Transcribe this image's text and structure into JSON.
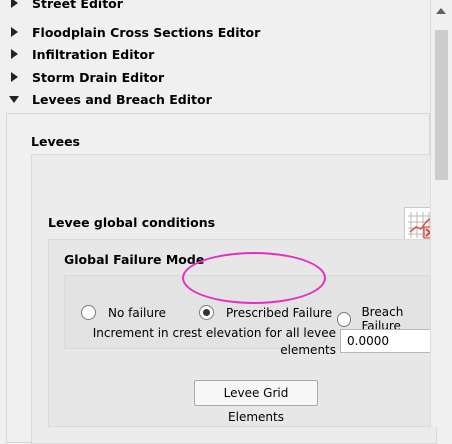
{
  "toolbox": {
    "items": [
      {
        "label": "Street Editor",
        "expanded": false
      },
      {
        "label": "Floodplain Cross Sections Editor",
        "expanded": false
      },
      {
        "label": "Infiltration Editor",
        "expanded": false
      },
      {
        "label": "Storm Drain Editor",
        "expanded": false
      },
      {
        "label": "Levees and Breach Editor",
        "expanded": true
      }
    ]
  },
  "levees_editor": {
    "levees_heading": "Levees",
    "global_conditions_heading": "Levee global conditions",
    "failure_mode": {
      "heading": "Global Failure Mode",
      "options": [
        "No failure",
        "Prescribed Failure",
        "Breach Failure"
      ],
      "selected": "Prescribed Failure"
    },
    "increment_label": "Increment in crest elevation for all levee elements",
    "increment_value": "0.0000",
    "grid_elements_button": "Levee Grid Elements"
  },
  "colors": {
    "highlight": "#e52fbf",
    "panel_background": "#f0f0f0",
    "grid_icon_red": "#d9534f"
  }
}
